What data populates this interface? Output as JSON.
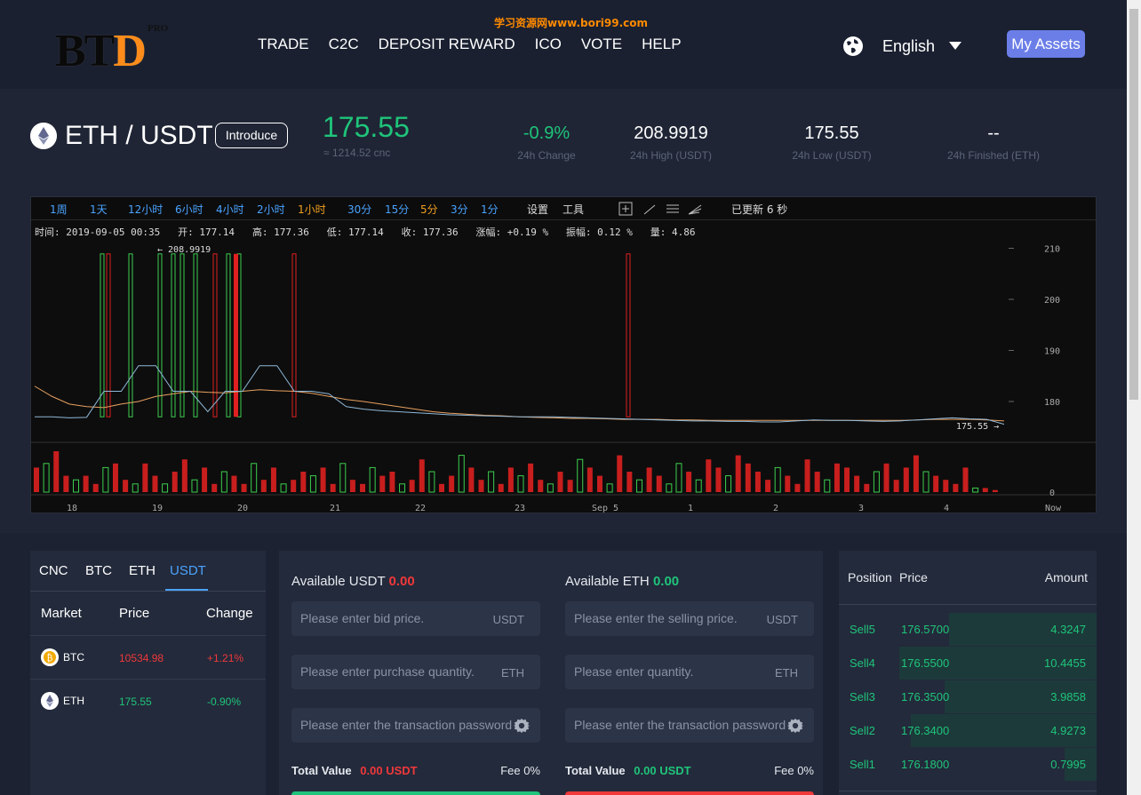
{
  "watermark": "学习资源网www.bori99.com",
  "logo": {
    "text": "BTD",
    "pro": "PRO"
  },
  "nav": [
    "TRADE",
    "C2C",
    "DEPOSIT REWARD",
    "ICO",
    "VOTE",
    "HELP"
  ],
  "language": "English",
  "my_assets": "My Assets",
  "pair": {
    "name": "ETH / USDT",
    "introduce": "Introduce",
    "price": "175.55",
    "cnc": "≈ 1214.52 cnc"
  },
  "stats": [
    {
      "value": "-0.9%",
      "label": "24h Change",
      "color": "#1fc47a"
    },
    {
      "value": "208.9919",
      "label": "24h High (USDT)",
      "color": "#ffffff"
    },
    {
      "value": "175.55",
      "label": "24h Low (USDT)",
      "color": "#ffffff"
    },
    {
      "value": "--",
      "label": "24h Finished (ETH)",
      "color": "#ffffff"
    }
  ],
  "chart_toolbar": {
    "periods": [
      "1周",
      "1天",
      "12小时",
      "6小时",
      "4小时",
      "2小时",
      "1小时",
      "30分",
      "15分",
      "5分",
      "3分",
      "1分"
    ],
    "settings": "设置",
    "tools": "工具",
    "updated": "已更新 6 秒"
  },
  "chart_info": "时间: 2019-09-05 00:35   开: 177.14   高: 177.36   低: 177.14   收: 177.36   涨幅: +0.19 %   振幅: 0.12 %   量: 4.86",
  "chart_data": {
    "type": "line",
    "title": "",
    "y_ticks": [
      "210",
      "200",
      "190",
      "180"
    ],
    "volume_ticks": [
      "0"
    ],
    "x_ticks": [
      "18",
      "19",
      "20",
      "21",
      "22",
      "23",
      "Sep 5",
      "1",
      "2",
      "3",
      "4",
      "Now"
    ],
    "high_marker": "← 208.9919",
    "last_marker": "175.55 →",
    "ylim": [
      172,
      212
    ],
    "close_series": [
      177,
      177,
      176.8,
      176.9,
      182,
      182,
      187,
      187,
      182,
      182,
      178,
      182,
      182,
      187,
      187,
      182,
      182,
      181.5,
      179,
      178.5,
      178.2,
      178,
      177.8,
      177.6,
      177.4,
      177.3,
      177.2,
      177.1,
      177,
      177,
      177,
      176.9,
      176.8,
      176.7,
      176.6,
      176.5,
      176.4,
      176.3,
      176.2,
      176.2,
      176.1,
      176.1,
      176,
      176,
      176.2,
      176.4,
      176.3,
      176.3,
      176.2,
      176.1,
      176.2,
      176.4,
      176.6,
      176.8,
      176.6,
      176.5,
      175.55
    ],
    "ma_series": [
      183,
      181,
      179.5,
      179,
      178.8,
      179.5,
      180,
      181,
      181.5,
      182,
      181.8,
      181.7,
      182,
      182.3,
      182.1,
      182,
      181.6,
      181,
      180.4,
      180,
      179.5,
      179,
      178.5,
      178,
      177.7,
      177.5,
      177.3,
      177.2,
      177,
      176.9,
      176.8,
      176.7,
      176.7,
      176.6,
      176.5,
      176.5,
      176.5,
      176.4,
      176.4,
      176.3,
      176.3,
      176.3,
      176.3,
      176.3,
      176.3,
      176.3,
      176.3,
      176.3,
      176.3,
      176.3,
      176.3,
      176.4,
      176.5,
      176.5,
      176.5,
      176.4,
      176.2
    ],
    "volumes": [
      0.6,
      0.7,
      1.0,
      0.4,
      0.3,
      0.4,
      0.2,
      0.6,
      0.7,
      0.3,
      0.2,
      0.7,
      0.4,
      0.2,
      0.5,
      0.8,
      0.3,
      0.6,
      0.2,
      0.5,
      0.4,
      0.2,
      0.7,
      0.3,
      0.6,
      0.2,
      0.3,
      0.5,
      0.4,
      0.6,
      0.2,
      0.7,
      0.3,
      0.2,
      0.6,
      0.4,
      0.5,
      0.2,
      0.3,
      0.8,
      0.5,
      0.2,
      0.4,
      0.9,
      0.6,
      0.3,
      0.5,
      0.2,
      0.6,
      0.4,
      0.7,
      0.3,
      0.2,
      0.5,
      0.3,
      0.8,
      0.6,
      0.4,
      0.2,
      0.9,
      0.5,
      0.3,
      0.6,
      0.4,
      0.2,
      0.7,
      0.5,
      0.3,
      0.8,
      0.6,
      0.4,
      0.9,
      0.7,
      0.5,
      0.3,
      0.6,
      0.4,
      0.2,
      0.8,
      0.5,
      0.3,
      0.7,
      0.6,
      0.4,
      0.2,
      0.5,
      0.7,
      0.3,
      0.6,
      0.9,
      0.5,
      0.4,
      0.3,
      0.2,
      0.6,
      0.1,
      0.1,
      0.05
    ]
  },
  "market_tabs": [
    "CNC",
    "BTC",
    "ETH",
    "USDT"
  ],
  "market_head": {
    "market": "Market",
    "price": "Price",
    "change": "Change"
  },
  "markets": [
    {
      "name": "BTC",
      "price": "10534.98",
      "change": "+1.21%",
      "color": "#f0383a"
    },
    {
      "name": "ETH",
      "price": "175.55",
      "change": "-0.90%",
      "color": "#1fc47a"
    }
  ],
  "buy": {
    "available_label": "Available USDT",
    "available": "0.00",
    "price_ph": "Please enter bid price.",
    "price_unit": "USDT",
    "qty_ph": "Please enter purchase quantity.",
    "qty_unit": "ETH",
    "pwd_ph": "Please enter the transaction password",
    "total_label": "Total Value",
    "total": "0.00 USDT",
    "fee": "Fee 0%"
  },
  "sell": {
    "available_label": "Available ETH",
    "available": "0.00",
    "price_ph": "Please enter the selling price.",
    "price_unit": "USDT",
    "qty_ph": "Please enter quantity.",
    "qty_unit": "ETH",
    "pwd_ph": "Please enter the transaction password",
    "total_label": "Total Value",
    "total": "0.00 USDT",
    "fee": "Fee 0%"
  },
  "orderbook": {
    "head": {
      "position": "Position",
      "price": "Price",
      "amount": "Amount"
    },
    "rows": [
      {
        "pos": "Sell5",
        "price": "176.5700",
        "amount": "4.3247",
        "depth": 0.75
      },
      {
        "pos": "Sell4",
        "price": "176.5500",
        "amount": "10.4455",
        "depth": 1.0
      },
      {
        "pos": "Sell3",
        "price": "176.3500",
        "amount": "3.9858",
        "depth": 0.77
      },
      {
        "pos": "Sell2",
        "price": "176.3400",
        "amount": "4.9273",
        "depth": 0.94
      },
      {
        "pos": "Sell1",
        "price": "176.1800",
        "amount": "0.7995",
        "depth": 0.16
      }
    ]
  }
}
